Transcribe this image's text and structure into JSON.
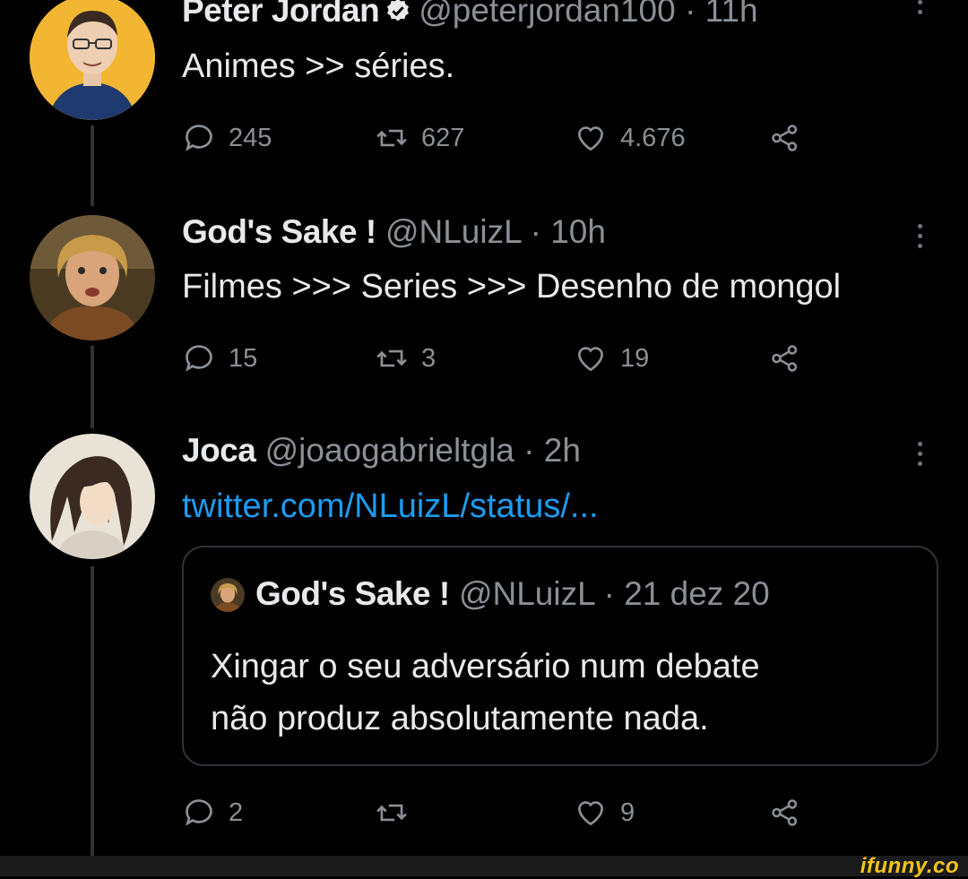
{
  "tweets": [
    {
      "name": "Peter Jordan",
      "handle": "@peterjordan100",
      "time": "· 11h",
      "text": "Animes >> séries.",
      "replies": "245",
      "retweets": "627",
      "likes": "4.676"
    },
    {
      "name": "God's Sake !",
      "handle": "@NLuizL",
      "time": "· 10h",
      "text": "Filmes >>> Series >>> Desenho de mongol",
      "replies": "15",
      "retweets": "3",
      "likes": "19"
    },
    {
      "name": "Joca",
      "handle": "@joaogabrieltgla",
      "time": "· 2h",
      "text": "twitter.com/NLuizL/status/...",
      "replies": "2",
      "retweets": "",
      "likes": "9",
      "quote": {
        "name": "God's Sake !",
        "handle": "@NLuizL",
        "time": "· 21 dez 20",
        "line1": "Xingar o seu adversário num debate",
        "line2": "não produz absolutamente nada."
      }
    }
  ],
  "watermark": "ifunny.co",
  "colors": {
    "background": "#000000",
    "text": "#e7e9ea",
    "muted": "#8b9096",
    "link": "#1d9bf0",
    "verified": "#e7e9ea",
    "watermark": "#f5c518"
  },
  "icons": [
    "reply-icon",
    "retweet-icon",
    "like-icon",
    "share-icon",
    "more-icon",
    "verified-badge-icon"
  ]
}
